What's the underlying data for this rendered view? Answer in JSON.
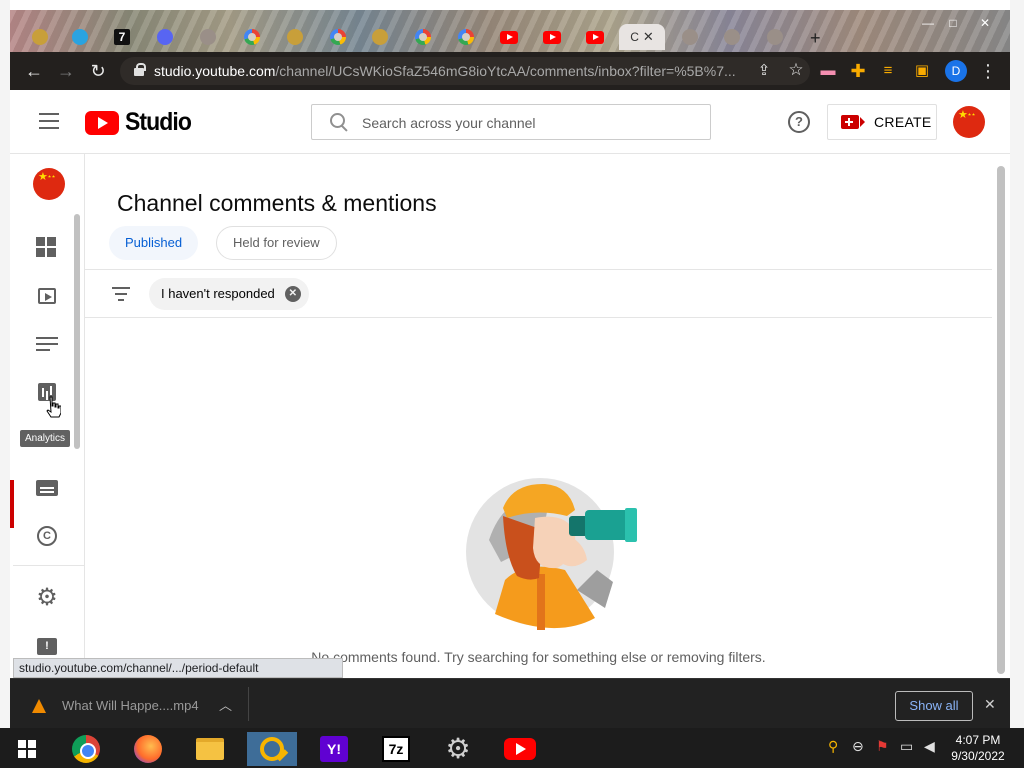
{
  "browser": {
    "url_host": "studio.youtube.com",
    "url_path": "/channel/UCsWKioSfaZ546mG8ioYtcAA/comments/inbox?filter=%5B%7...",
    "profile_initial": "D",
    "seven_tab_label": "7",
    "active_tab_letter": "C",
    "status_url": "studio.youtube.com/channel/.../period-default"
  },
  "studio": {
    "logo_text": "Studio",
    "search_placeholder": "Search across your channel",
    "help_label": "?",
    "create_label": "CREATE"
  },
  "sidebar": {
    "tooltip": "Analytics",
    "copyright_label": "C",
    "feedback_label": "!"
  },
  "content": {
    "title": "Channel comments & mentions",
    "tabs": [
      {
        "label": "Published",
        "selected": true
      },
      {
        "label": "Held for review",
        "selected": false
      }
    ],
    "filter_chip": "I haven't responded",
    "empty_message": "No comments found. Try searching for something else or removing filters."
  },
  "downloads": {
    "file_name": "What Will Happe....mp4",
    "show_all": "Show all"
  },
  "taskbar": {
    "yahoo_label": "Y!",
    "sevenzip_label": "7z",
    "time": "4:07 PM",
    "date": "9/30/2022"
  },
  "colors": {
    "yt_red": "#ff0000",
    "link_blue": "#065fd4",
    "toolbar_dark": "#23201e"
  }
}
